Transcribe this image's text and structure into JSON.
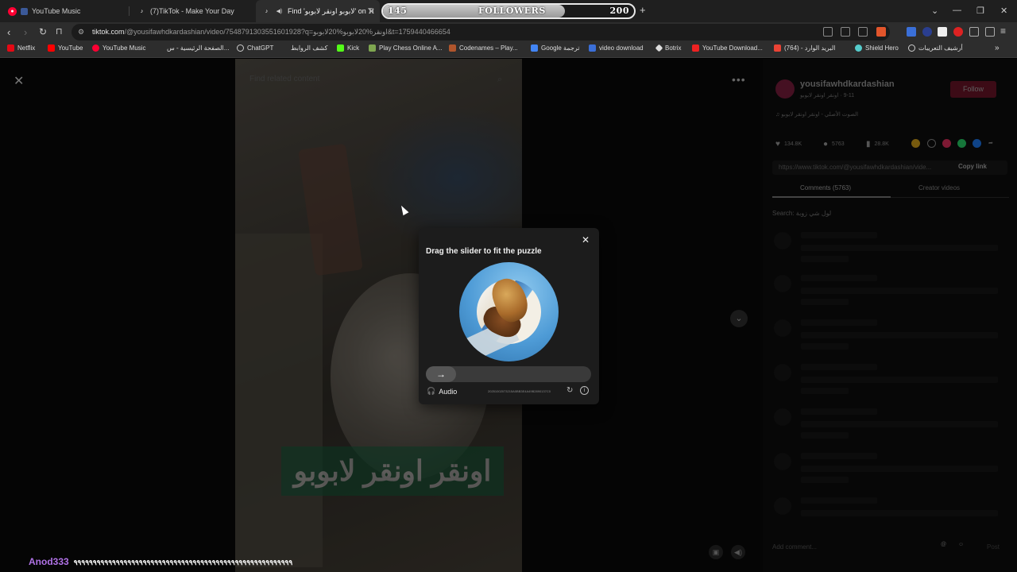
{
  "browser": {
    "tabs": [
      {
        "title": "YouTube Music",
        "icon": "youtube-music-icon"
      },
      {
        "title": "(7)TikTok - Make Your Day",
        "icon": "tiktok-icon"
      },
      {
        "title": "Find 'لابوبو اونقر لابوبو' on Ti",
        "icon": "tiktok-icon"
      }
    ],
    "url_domain": "tiktok.com",
    "url_rest": "/@yousifawhdkardashian/video/7548791303551601928?q=اونقر%20لابوبو%20لابوبو&t=1759440466654",
    "bookmarks": [
      "Netflix",
      "YouTube",
      "YouTube Music",
      "الصفحة الرئيسية - س...",
      "ChatGPT",
      "كشف الروابط",
      "Kick",
      "Play Chess Online A...",
      "Codenames – Play...",
      "Google ترجمة",
      "video download",
      "Botrix",
      "YouTube Download...",
      "(764) - البريد الوارد",
      "Shield Hero",
      "أرشيف التعريبات"
    ]
  },
  "follower_goal": {
    "current": "145",
    "label": "FOLLOWERS",
    "target": "200",
    "progress": 0.725
  },
  "tiktok": {
    "search_placeholder": "Find related content",
    "caption": "اونقر اونقر لابوبو",
    "creator": {
      "username": "yousifawhdkardashian",
      "subtitle": "9-11 · اونقر اونقر لابوبو",
      "follow_label": "Follow"
    },
    "sound": "الصوت الأصلي - اونقر اونقر لابوبو",
    "stats": {
      "likes": "134.8K",
      "comments": "5763",
      "saves": "28.8K"
    },
    "link": "https://www.tiktok.com/@yousifawhdkardashian/vide...",
    "copy_link": "Copy link",
    "tabs": [
      "Comments (5763)",
      "Creator videos"
    ],
    "comment_search": "Search: لول شي زوبة",
    "add_comment": "Add comment...",
    "post_label": "Post"
  },
  "captcha": {
    "title": "Drag the slider to fit the puzzle",
    "audio_label": "Audio",
    "request_id": "20251002073215A0BB3E4A49B2890137C0",
    "slider_position": 0
  },
  "stream_chat": {
    "user": "Anod333",
    "message": "٩٩٩٩٩٩٩٩٩٩٩٩٩٩٩٩٩٩٩٩٩٩٩٩٩٩٩٩٩٩٩٩٩٩٩٩٩٩٩٩٩٩٩٩٩٩٩٩٩٩٩٩٩٩٩٩٩"
  }
}
